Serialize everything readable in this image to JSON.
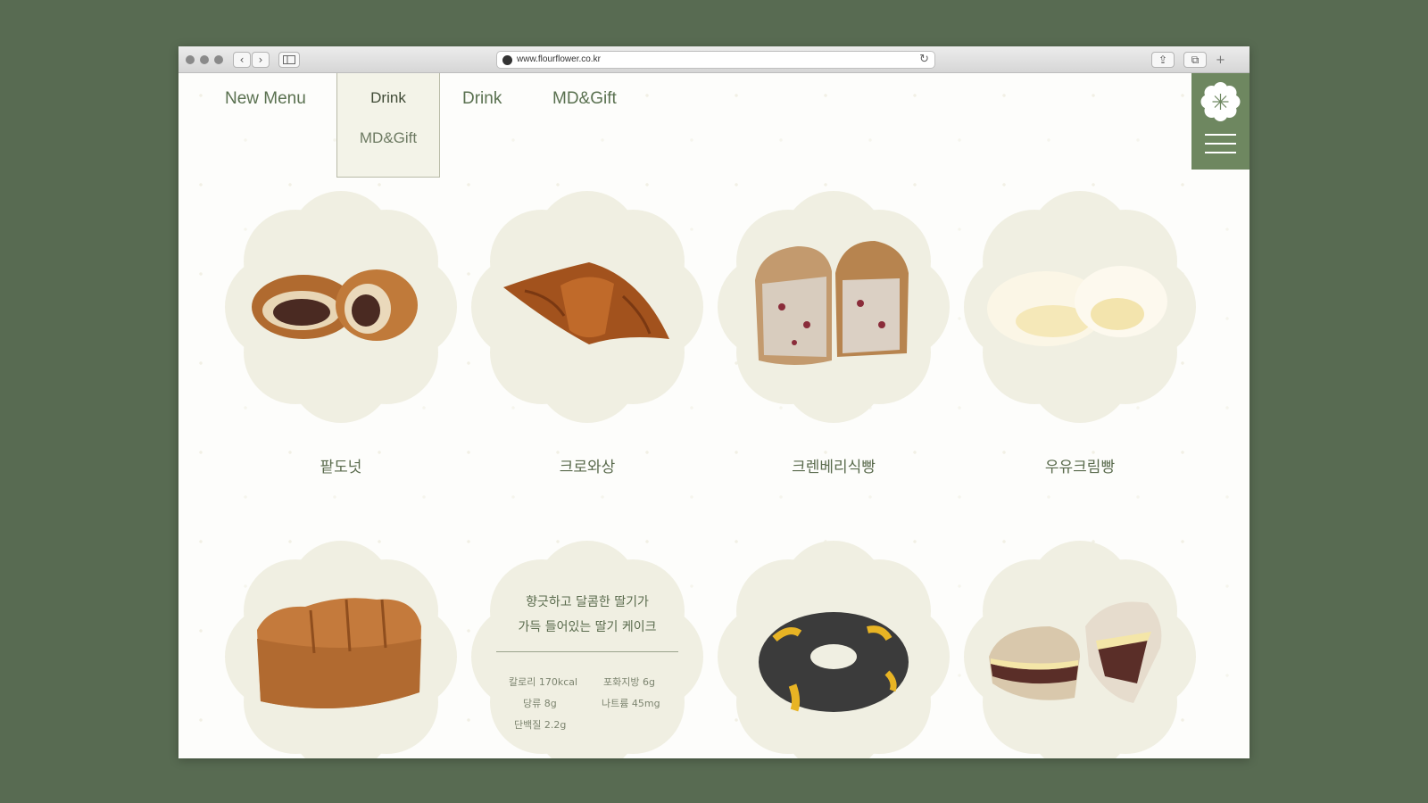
{
  "browser": {
    "url": "www.flourflower.co.kr"
  },
  "nav": {
    "new_menu": "New Menu",
    "dropdown_drink": "Drink",
    "dropdown_mdgift": "MD&Gift",
    "drink": "Drink",
    "mdgift": "MD&Gift"
  },
  "products": [
    {
      "name": "팥도넛"
    },
    {
      "name": "크로와상"
    },
    {
      "name": "크렌베리식빵"
    },
    {
      "name": "우유크림빵"
    }
  ],
  "info_card": {
    "line1": "향긋하고 달콤한 딸기가",
    "line2": "가득 들어있는 딸기 케이크",
    "calories": "칼로리 170kcal",
    "saturated_fat": "포화지방 6g",
    "sugar": "당류 8g",
    "sodium": "나트륨 45mg",
    "protein": "단백질 2.2g"
  },
  "colors": {
    "background": "#586b52",
    "accent": "#6e8760",
    "flower": "#f0efe2",
    "text": "#5a7150"
  }
}
